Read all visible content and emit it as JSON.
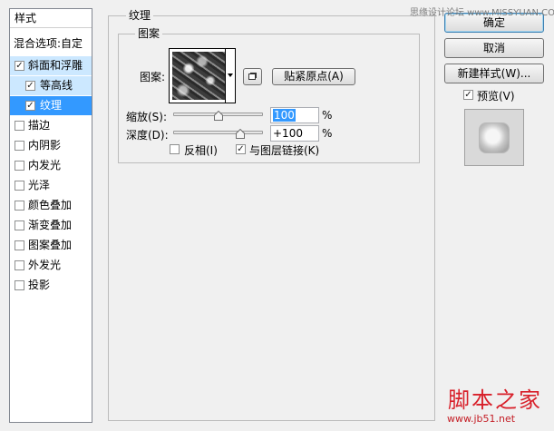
{
  "style_list": {
    "header": "样式",
    "blend_options": "混合选项:自定",
    "items": [
      {
        "label": "斜面和浮雕",
        "checked": true,
        "state": "parent"
      },
      {
        "label": "等高线",
        "checked": true,
        "state": "sub"
      },
      {
        "label": "纹理",
        "checked": true,
        "state": "selected"
      },
      {
        "label": "描边",
        "checked": false
      },
      {
        "label": "内阴影",
        "checked": false
      },
      {
        "label": "内发光",
        "checked": false
      },
      {
        "label": "光泽",
        "checked": false
      },
      {
        "label": "颜色叠加",
        "checked": false
      },
      {
        "label": "渐变叠加",
        "checked": false
      },
      {
        "label": "图案叠加",
        "checked": false
      },
      {
        "label": "外发光",
        "checked": false
      },
      {
        "label": "投影",
        "checked": false
      }
    ],
    "check_glyph": "✓"
  },
  "texture_panel": {
    "title": "纹理",
    "pattern_group_title": "图案",
    "pattern_label": "图案:",
    "snap_to_origin": "贴紧原点(A)",
    "scale_label": "缩放(S):",
    "scale_value": "100",
    "scale_unit": "%",
    "scale_fraction": 0.5,
    "depth_label": "深度(D):",
    "depth_value": "+100",
    "depth_unit": "%",
    "depth_fraction": 0.75,
    "invert_label": "反相(I)",
    "invert_checked": false,
    "link_label": "与图层链接(K)",
    "link_checked": true
  },
  "right_panel": {
    "ok": "确定",
    "cancel": "取消",
    "new_style": "新建样式(W)...",
    "preview_label": "预览(V)",
    "preview_checked": true
  },
  "watermarks": {
    "top": "思缘设计论坛 www.MISSYUAN.COM",
    "bottom_cn": "脚本之家",
    "bottom_url": "www.jb51.net"
  },
  "icons": {
    "new_pattern": "new-preset-icon",
    "pattern_dropdown": "chevron-down-icon",
    "slider_thumb": "triangle-slider-thumb-icon"
  }
}
